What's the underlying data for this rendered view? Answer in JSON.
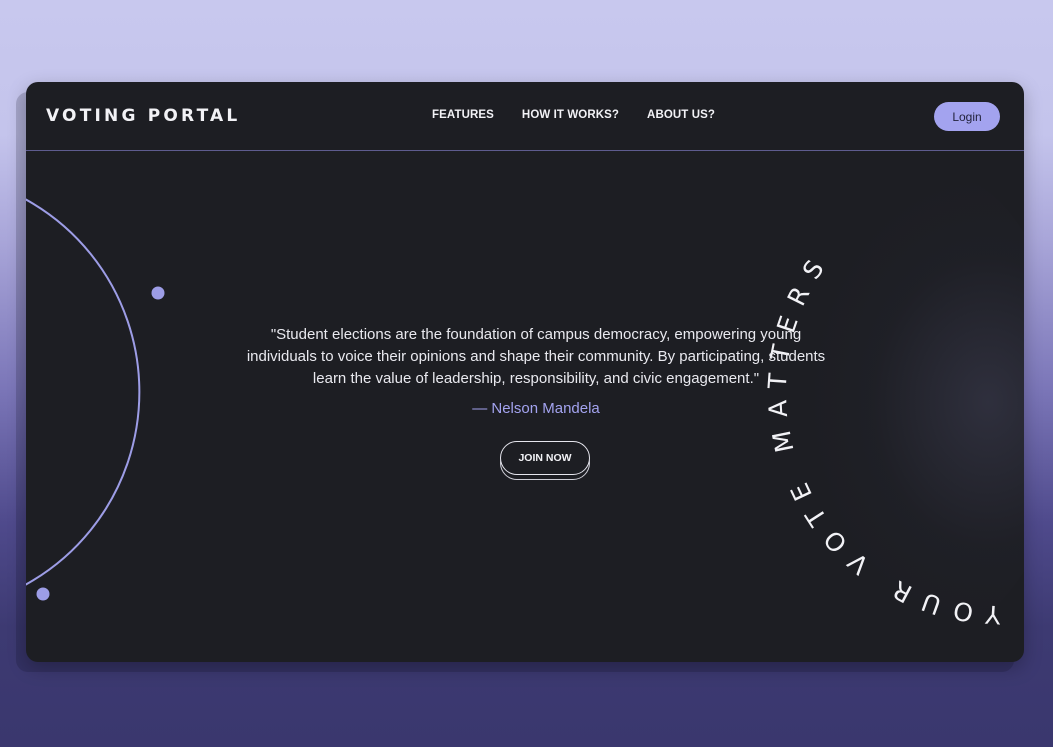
{
  "header": {
    "brand": "VOTING PORTAL",
    "nav": [
      "FEATURES",
      "HOW IT WORKS?",
      "ABOUT US?"
    ],
    "login_label": "Login"
  },
  "hero": {
    "quote_lines": [
      "\"Student elections are the foundation of campus democracy, empowering young",
      "individuals to voice their opinions and shape their community. By participating, students",
      "learn the value of leadership, responsibility, and civic engagement.\""
    ],
    "author": "— Nelson Mandela",
    "cta_label": "JOIN NOW"
  },
  "decor": {
    "circular_text": "YOUR VOTE MATTERS"
  },
  "colors": {
    "accent": "#a3a3ef",
    "window_bg": "#1d1e23",
    "arc": "#9d9de6"
  }
}
